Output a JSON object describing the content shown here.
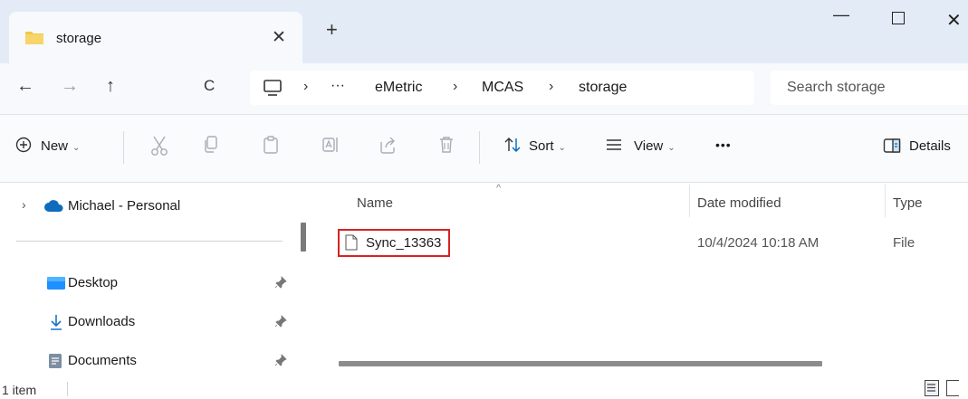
{
  "tab": {
    "title": "storage",
    "close": "✕",
    "new": "+"
  },
  "window": {
    "minimize": "—",
    "close": "✕"
  },
  "nav": {
    "back": "←",
    "forward": "→",
    "up": "↑",
    "refresh": "C",
    "separator": "›",
    "ellipsis": "···",
    "breadcrumbs": [
      "eMetric",
      "MCAS",
      "storage"
    ]
  },
  "search": {
    "placeholder": "Search storage"
  },
  "commandbar": {
    "new_label": "New",
    "sort_label": "Sort",
    "view_label": "View",
    "more": "•••",
    "details_label": "Details",
    "chevron": "⌄"
  },
  "sidebar": {
    "cloud_item": "Michael - Personal",
    "quick_access": [
      {
        "label": "Desktop",
        "icon": "desktop-icon"
      },
      {
        "label": "Downloads",
        "icon": "download-icon"
      },
      {
        "label": "Documents",
        "icon": "documents-icon"
      }
    ]
  },
  "filelist": {
    "columns": [
      "Name",
      "Date modified",
      "Type"
    ],
    "sort_indicator": "^",
    "rows": [
      {
        "name": "Sync_13363",
        "date_modified": "10/4/2024 10:18 AM",
        "type": "File"
      }
    ]
  },
  "status": {
    "item_count": "1 item"
  },
  "colors": {
    "titlebar": "#e3ecf6",
    "accent": "#0067c0",
    "highlight_border": "#d62323"
  }
}
